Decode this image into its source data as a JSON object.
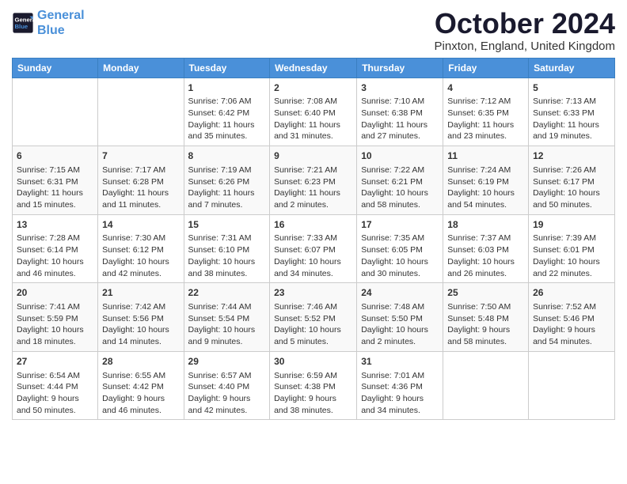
{
  "header": {
    "logo_line1": "General",
    "logo_line2": "Blue",
    "month": "October 2024",
    "location": "Pinxton, England, United Kingdom"
  },
  "days_of_week": [
    "Sunday",
    "Monday",
    "Tuesday",
    "Wednesday",
    "Thursday",
    "Friday",
    "Saturday"
  ],
  "weeks": [
    [
      {
        "day": "",
        "info": ""
      },
      {
        "day": "",
        "info": ""
      },
      {
        "day": "1",
        "info": "Sunrise: 7:06 AM\nSunset: 6:42 PM\nDaylight: 11 hours and 35 minutes."
      },
      {
        "day": "2",
        "info": "Sunrise: 7:08 AM\nSunset: 6:40 PM\nDaylight: 11 hours and 31 minutes."
      },
      {
        "day": "3",
        "info": "Sunrise: 7:10 AM\nSunset: 6:38 PM\nDaylight: 11 hours and 27 minutes."
      },
      {
        "day": "4",
        "info": "Sunrise: 7:12 AM\nSunset: 6:35 PM\nDaylight: 11 hours and 23 minutes."
      },
      {
        "day": "5",
        "info": "Sunrise: 7:13 AM\nSunset: 6:33 PM\nDaylight: 11 hours and 19 minutes."
      }
    ],
    [
      {
        "day": "6",
        "info": "Sunrise: 7:15 AM\nSunset: 6:31 PM\nDaylight: 11 hours and 15 minutes."
      },
      {
        "day": "7",
        "info": "Sunrise: 7:17 AM\nSunset: 6:28 PM\nDaylight: 11 hours and 11 minutes."
      },
      {
        "day": "8",
        "info": "Sunrise: 7:19 AM\nSunset: 6:26 PM\nDaylight: 11 hours and 7 minutes."
      },
      {
        "day": "9",
        "info": "Sunrise: 7:21 AM\nSunset: 6:23 PM\nDaylight: 11 hours and 2 minutes."
      },
      {
        "day": "10",
        "info": "Sunrise: 7:22 AM\nSunset: 6:21 PM\nDaylight: 10 hours and 58 minutes."
      },
      {
        "day": "11",
        "info": "Sunrise: 7:24 AM\nSunset: 6:19 PM\nDaylight: 10 hours and 54 minutes."
      },
      {
        "day": "12",
        "info": "Sunrise: 7:26 AM\nSunset: 6:17 PM\nDaylight: 10 hours and 50 minutes."
      }
    ],
    [
      {
        "day": "13",
        "info": "Sunrise: 7:28 AM\nSunset: 6:14 PM\nDaylight: 10 hours and 46 minutes."
      },
      {
        "day": "14",
        "info": "Sunrise: 7:30 AM\nSunset: 6:12 PM\nDaylight: 10 hours and 42 minutes."
      },
      {
        "day": "15",
        "info": "Sunrise: 7:31 AM\nSunset: 6:10 PM\nDaylight: 10 hours and 38 minutes."
      },
      {
        "day": "16",
        "info": "Sunrise: 7:33 AM\nSunset: 6:07 PM\nDaylight: 10 hours and 34 minutes."
      },
      {
        "day": "17",
        "info": "Sunrise: 7:35 AM\nSunset: 6:05 PM\nDaylight: 10 hours and 30 minutes."
      },
      {
        "day": "18",
        "info": "Sunrise: 7:37 AM\nSunset: 6:03 PM\nDaylight: 10 hours and 26 minutes."
      },
      {
        "day": "19",
        "info": "Sunrise: 7:39 AM\nSunset: 6:01 PM\nDaylight: 10 hours and 22 minutes."
      }
    ],
    [
      {
        "day": "20",
        "info": "Sunrise: 7:41 AM\nSunset: 5:59 PM\nDaylight: 10 hours and 18 minutes."
      },
      {
        "day": "21",
        "info": "Sunrise: 7:42 AM\nSunset: 5:56 PM\nDaylight: 10 hours and 14 minutes."
      },
      {
        "day": "22",
        "info": "Sunrise: 7:44 AM\nSunset: 5:54 PM\nDaylight: 10 hours and 9 minutes."
      },
      {
        "day": "23",
        "info": "Sunrise: 7:46 AM\nSunset: 5:52 PM\nDaylight: 10 hours and 5 minutes."
      },
      {
        "day": "24",
        "info": "Sunrise: 7:48 AM\nSunset: 5:50 PM\nDaylight: 10 hours and 2 minutes."
      },
      {
        "day": "25",
        "info": "Sunrise: 7:50 AM\nSunset: 5:48 PM\nDaylight: 9 hours and 58 minutes."
      },
      {
        "day": "26",
        "info": "Sunrise: 7:52 AM\nSunset: 5:46 PM\nDaylight: 9 hours and 54 minutes."
      }
    ],
    [
      {
        "day": "27",
        "info": "Sunrise: 6:54 AM\nSunset: 4:44 PM\nDaylight: 9 hours and 50 minutes."
      },
      {
        "day": "28",
        "info": "Sunrise: 6:55 AM\nSunset: 4:42 PM\nDaylight: 9 hours and 46 minutes."
      },
      {
        "day": "29",
        "info": "Sunrise: 6:57 AM\nSunset: 4:40 PM\nDaylight: 9 hours and 42 minutes."
      },
      {
        "day": "30",
        "info": "Sunrise: 6:59 AM\nSunset: 4:38 PM\nDaylight: 9 hours and 38 minutes."
      },
      {
        "day": "31",
        "info": "Sunrise: 7:01 AM\nSunset: 4:36 PM\nDaylight: 9 hours and 34 minutes."
      },
      {
        "day": "",
        "info": ""
      },
      {
        "day": "",
        "info": ""
      }
    ]
  ]
}
